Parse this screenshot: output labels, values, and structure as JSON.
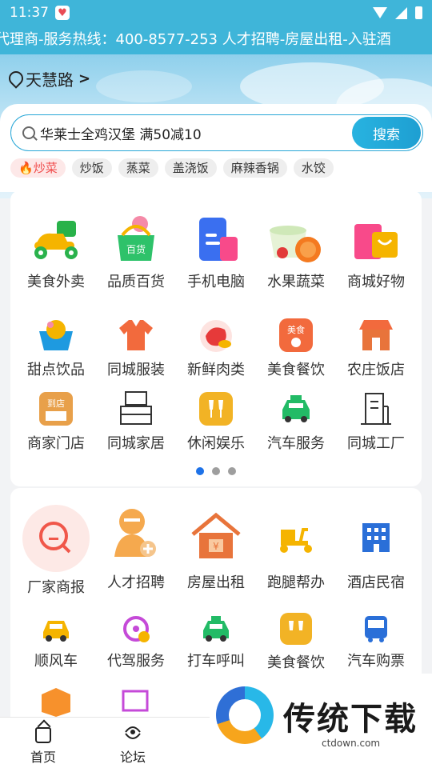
{
  "status_bar": {
    "time": "11:37"
  },
  "notice": {
    "text": "代理商-服务热线：400-8577-253 人才招聘-房屋出租-入驻酒"
  },
  "location": {
    "name": "天慧路"
  },
  "search": {
    "value": "华莱士全鸡汉堡 满50减10",
    "button_label": "搜索"
  },
  "hot_tags": [
    {
      "label": "炒菜",
      "hot": true
    },
    {
      "label": "炒饭"
    },
    {
      "label": "蒸菜"
    },
    {
      "label": "盖浇饭"
    },
    {
      "label": "麻辣香锅"
    },
    {
      "label": "水饺"
    }
  ],
  "categories_page1": [
    {
      "label": "美食外卖",
      "icon": "scooter-icon",
      "color": "#f5b400"
    },
    {
      "label": "品质百货",
      "icon": "shopping-basket-icon",
      "color": "#2ec26a"
    },
    {
      "label": "手机电脑",
      "icon": "phone-computer-icon",
      "color": "#3a6ff0"
    },
    {
      "label": "水果蔬菜",
      "icon": "fruit-bowl-icon",
      "color": "#f47a20"
    },
    {
      "label": "商城好物",
      "icon": "shopping-bag-icon",
      "color": "#f84a8a"
    },
    {
      "label": "甜点饮品",
      "icon": "dessert-icon",
      "color": "#1e9ae0"
    },
    {
      "label": "同城服装",
      "icon": "shirt-icon",
      "color": "#f26a3d"
    },
    {
      "label": "新鲜肉类",
      "icon": "meat-icon",
      "color": "#e63a3a"
    },
    {
      "label": "美食餐饮",
      "icon": "dining-icon",
      "color": "#f26a3d"
    },
    {
      "label": "农庄饭店",
      "icon": "farm-store-icon",
      "color": "#e8743b"
    },
    {
      "label": "商家门店",
      "icon": "store-icon",
      "color": "#e8a04a"
    },
    {
      "label": "同城家居",
      "icon": "furniture-icon",
      "color": "#333333"
    },
    {
      "label": "休闲娱乐",
      "icon": "cheers-icon",
      "color": "#f2b325"
    },
    {
      "label": "汽车服务",
      "icon": "car-icon",
      "color": "#22bb66"
    },
    {
      "label": "同城工厂",
      "icon": "factory-icon",
      "color": "#333333"
    }
  ],
  "pager": {
    "total": 3,
    "active": 0
  },
  "categories_page2": [
    {
      "label": "厂家商报",
      "icon": "search-report-icon",
      "color": "#f0574a"
    },
    {
      "label": "人才招聘",
      "icon": "recruit-icon",
      "color": "#f5a94e"
    },
    {
      "label": "房屋出租",
      "icon": "house-icon",
      "color": "#e8743b"
    },
    {
      "label": "跑腿帮办",
      "icon": "delivery-scooter-icon",
      "color": "#f5b400"
    },
    {
      "label": "酒店民宿",
      "icon": "hotel-icon",
      "color": "#2a6fd8"
    },
    {
      "label": "顺风车",
      "icon": "carpool-icon",
      "color": "#f5b400"
    },
    {
      "label": "代驾服务",
      "icon": "steering-wheel-icon",
      "color": "#c54ad8"
    },
    {
      "label": "打车呼叫",
      "icon": "taxi-icon",
      "color": "#22bb66"
    },
    {
      "label": "美食餐饮",
      "icon": "cheers-icon",
      "color": "#f2b325"
    },
    {
      "label": "汽车购票",
      "icon": "bus-icon",
      "color": "#2a6fd8"
    }
  ],
  "bottom_nav": [
    {
      "label": "首页",
      "icon": "home-icon"
    },
    {
      "label": "论坛",
      "icon": "forum-icon"
    }
  ],
  "watermark": {
    "title": "传统下载",
    "url": "ctdown.com"
  }
}
